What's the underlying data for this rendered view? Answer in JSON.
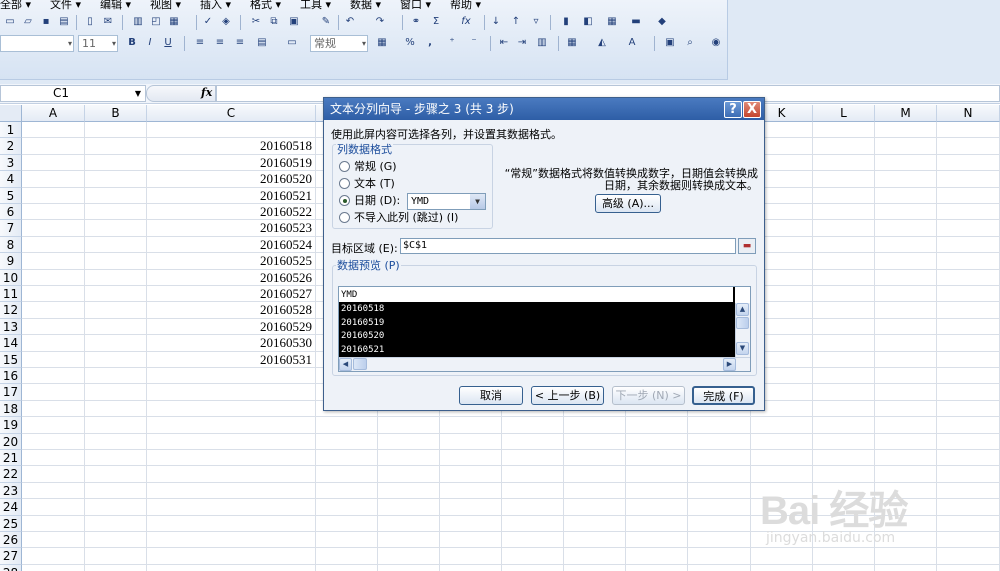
{
  "menubar": {
    "items": [
      "全部 ▾",
      "文件 ▾",
      "编辑 ▾",
      "视图 ▾",
      "插入 ▾",
      "格式 ▾",
      "工具 ▾",
      "数据 ▾",
      "窗口 ▾",
      "帮助 ▾"
    ]
  },
  "toolbar": {
    "font_size": "11",
    "number_format": "常规",
    "percent": "%",
    "comma": ",",
    "bold": "B",
    "italic": "I",
    "underline": "U",
    "sigma": "Σ",
    "fx": "fx"
  },
  "formula_bar": {
    "name_box": "C1",
    "fx_label": "fx",
    "content": ""
  },
  "sheet": {
    "columns": [
      "A",
      "B",
      "C",
      "D",
      "E",
      "F",
      "G",
      "H",
      "I",
      "J",
      "K",
      "L",
      "M",
      "N"
    ],
    "rows": [
      "1",
      "2",
      "3",
      "4",
      "5",
      "6",
      "7",
      "8",
      "9",
      "10",
      "11",
      "12",
      "13",
      "14",
      "15",
      "16",
      "17",
      "18",
      "19",
      "20",
      "21",
      "22",
      "23",
      "24",
      "25",
      "26",
      "27",
      "28"
    ],
    "column_c_values": [
      "20160518",
      "20160519",
      "20160520",
      "20160521",
      "20160522",
      "20160523",
      "20160524",
      "20160525",
      "20160526",
      "20160527",
      "20160528",
      "20160529",
      "20160530",
      "20160531"
    ]
  },
  "dialog": {
    "title": "文本分列向导 - 步骤之 3 (共 3 步)",
    "help": "?",
    "close": "X",
    "description": "使用此屏内容可选择各列，并设置其数据格式。",
    "format_group_label": "列数据格式",
    "options": {
      "general": "常规 (G)",
      "text": "文本 (T)",
      "date": "日期 (D):",
      "skip": "不导入此列 (跳过) (I)"
    },
    "date_format": "YMD",
    "info": "“常规”数据格式将数值转换成数字，日期值会转换成日期，其余数据则转换成文本。",
    "advanced_button": "高级 (A)...",
    "destination_label": "目标区域 (E):",
    "destination_value": "$C$1",
    "preview_label": "数据预览 (P)",
    "preview_header": "YMD",
    "preview_rows": [
      "20160518",
      "20160519",
      "20160520",
      "20160521"
    ],
    "buttons": {
      "cancel": "取消",
      "back": "< 上一步 (B)",
      "next": "下一步 (N) >",
      "finish": "完成 (F)"
    }
  },
  "watermark": {
    "logo": "Bai 经验",
    "url": "jingyan.baidu.com"
  }
}
